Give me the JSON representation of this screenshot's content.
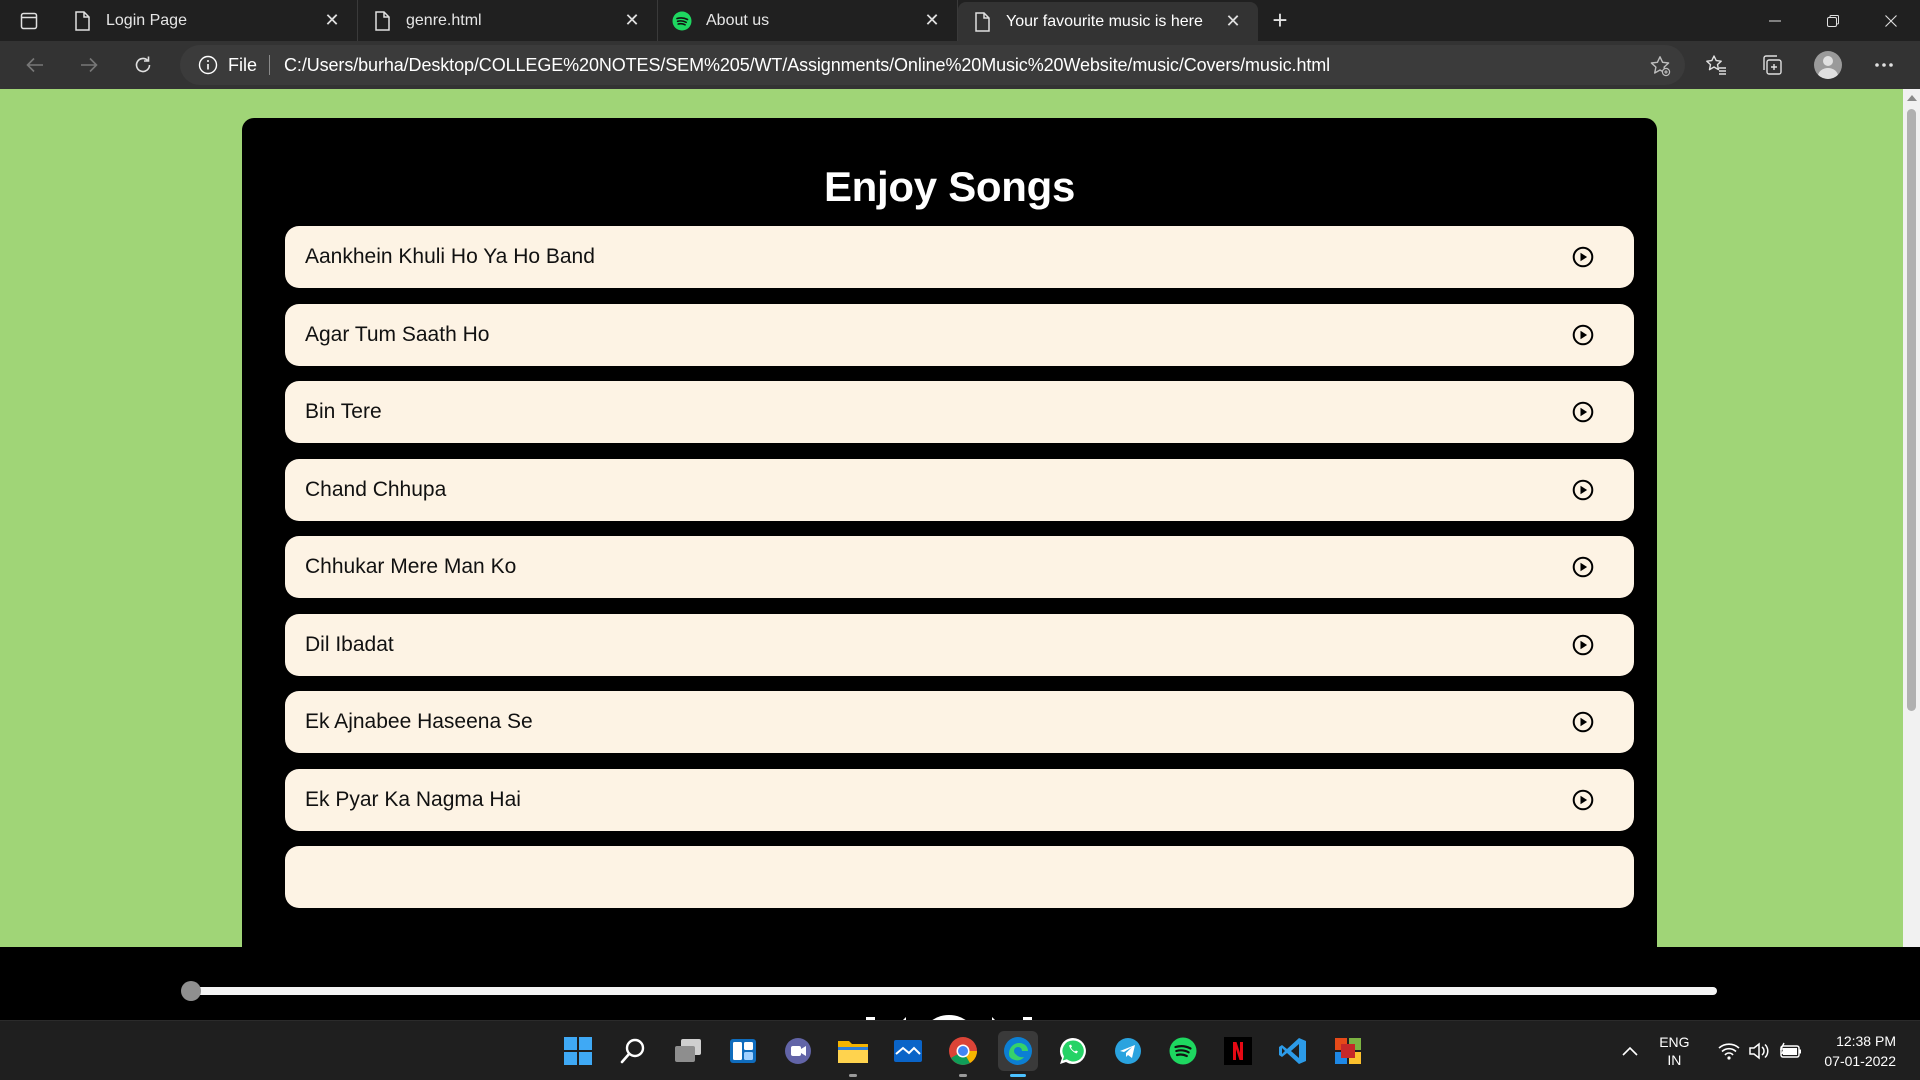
{
  "browser": {
    "tabs": [
      {
        "title": "Login Page",
        "icon": "page-icon"
      },
      {
        "title": "genre.html",
        "icon": "page-icon"
      },
      {
        "title": "About us",
        "icon": "spotify-icon"
      },
      {
        "title": "Your favourite music is here",
        "icon": "page-icon",
        "active": true
      }
    ],
    "address": {
      "scheme_label": "File",
      "url": "C:/Users/burha/Desktop/COLLEGE%20NOTES/SEM%205/WT/Assignments/Online%20Music%20Website/music/Covers/music.html"
    }
  },
  "page": {
    "heading": "Enjoy Songs",
    "songs": [
      "Aankhein Khuli Ho Ya Ho Band",
      "Agar Tum Saath Ho",
      "Bin Tere",
      "Chand Chhupa",
      "Chhukar Mere Man Ko",
      "Dil Ibadat",
      "Ek Ajnabee Haseena Se",
      "Ek Pyar Ka Nagma Hai"
    ],
    "background_color": "#a0d577"
  },
  "player": {
    "progress": 0,
    "controls": [
      "previous-icon",
      "play-icon",
      "next-icon"
    ]
  },
  "taskbar": {
    "apps": [
      "windows-start-icon",
      "search-icon",
      "task-view-icon",
      "widgets-icon",
      "teams-chat-icon",
      "file-explorer-icon",
      "mail-icon",
      "chrome-icon",
      "edge-icon",
      "whatsapp-icon",
      "telegram-icon",
      "spotify-icon",
      "netflix-icon",
      "vscode-icon",
      "office-icon"
    ],
    "language": {
      "line1": "ENG",
      "line2": "IN"
    },
    "clock": {
      "time": "12:38 PM",
      "date": "07-01-2022"
    }
  }
}
